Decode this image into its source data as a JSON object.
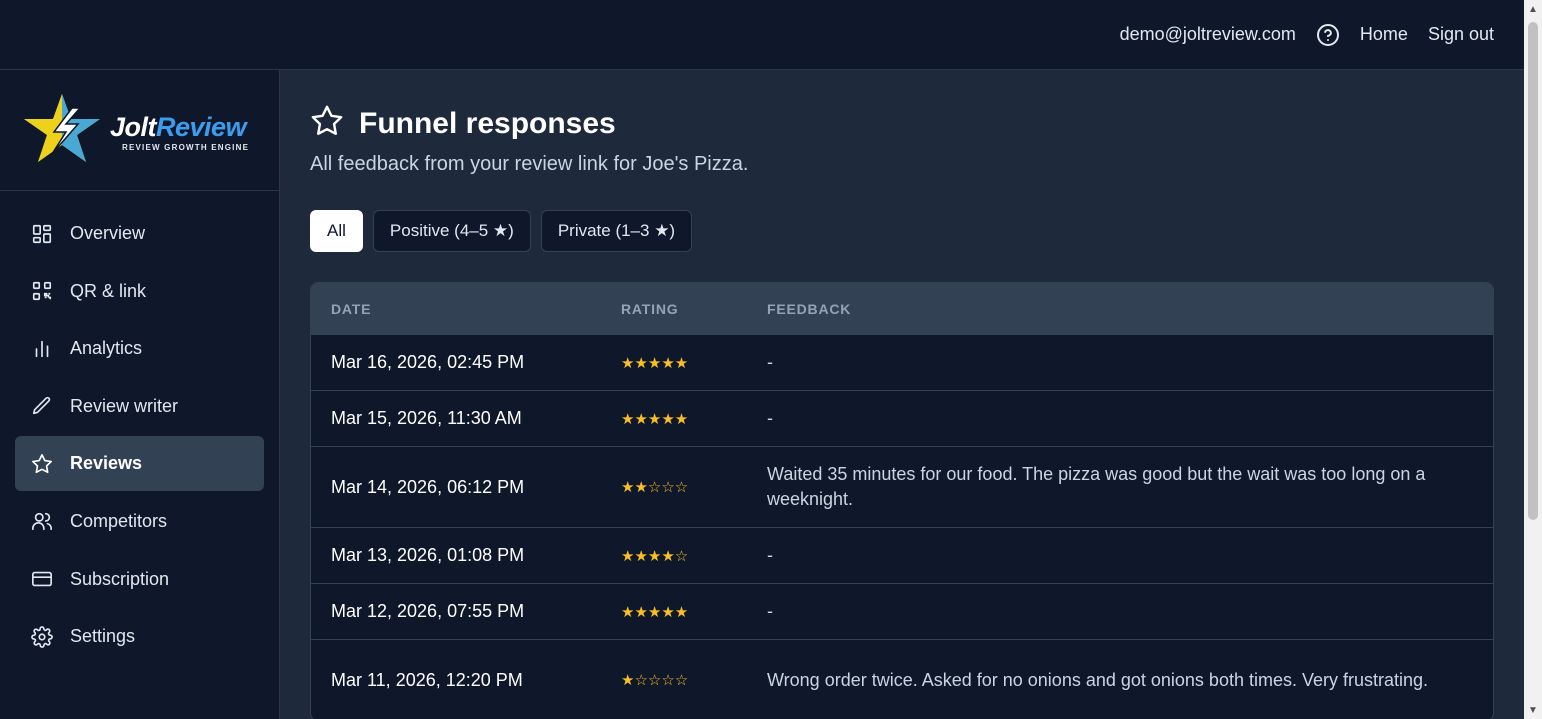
{
  "topbar": {
    "email": "demo@joltreview.com",
    "help_icon": "question-circle-icon",
    "home_label": "Home",
    "signout_label": "Sign out"
  },
  "brand": {
    "name_part1": "Jolt",
    "name_part2": "Review",
    "tagline": "REVIEW GROWTH ENGINE",
    "colors": {
      "accent_blue": "#3b9df0",
      "star_yellow": "#fbbf24",
      "star_green": "#a3e635"
    }
  },
  "sidebar": {
    "items": [
      {
        "label": "Overview",
        "icon": "grid-icon",
        "active": false
      },
      {
        "label": "QR & link",
        "icon": "qr-code-icon",
        "active": false
      },
      {
        "label": "Analytics",
        "icon": "bar-chart-icon",
        "active": false
      },
      {
        "label": "Review writer",
        "icon": "pencil-icon",
        "active": false
      },
      {
        "label": "Reviews",
        "icon": "star-icon",
        "active": true
      },
      {
        "label": "Competitors",
        "icon": "users-icon",
        "active": false
      },
      {
        "label": "Subscription",
        "icon": "credit-card-icon",
        "active": false
      },
      {
        "label": "Settings",
        "icon": "gear-icon",
        "active": false
      }
    ]
  },
  "page": {
    "title": "Funnel responses",
    "subtitle": "All feedback from your review link for Joe's Pizza."
  },
  "filters": [
    {
      "label": "All",
      "active": true
    },
    {
      "label": "Positive (4–5 ★)",
      "active": false
    },
    {
      "label": "Private (1–3 ★)",
      "active": false
    }
  ],
  "table": {
    "headers": {
      "date": "DATE",
      "rating": "RATING",
      "feedback": "FEEDBACK"
    },
    "rows": [
      {
        "date": "Mar 16, 2026, 02:45 PM",
        "rating": 5,
        "stars": "★★★★★",
        "feedback": "-"
      },
      {
        "date": "Mar 15, 2026, 11:30 AM",
        "rating": 5,
        "stars": "★★★★★",
        "feedback": "-"
      },
      {
        "date": "Mar 14, 2026, 06:12 PM",
        "rating": 2,
        "stars": "★★☆☆☆",
        "feedback": "Waited 35 minutes for our food. The pizza was good but the wait was too long on a weeknight."
      },
      {
        "date": "Mar 13, 2026, 01:08 PM",
        "rating": 4,
        "stars": "★★★★☆",
        "feedback": "-"
      },
      {
        "date": "Mar 12, 2026, 07:55 PM",
        "rating": 5,
        "stars": "★★★★★",
        "feedback": "-"
      },
      {
        "date": "Mar 11, 2026, 12:20 PM",
        "rating": 1,
        "stars": "★☆☆☆☆",
        "feedback": "Wrong order twice. Asked for no onions and got onions both times. Very frustrating."
      }
    ]
  }
}
